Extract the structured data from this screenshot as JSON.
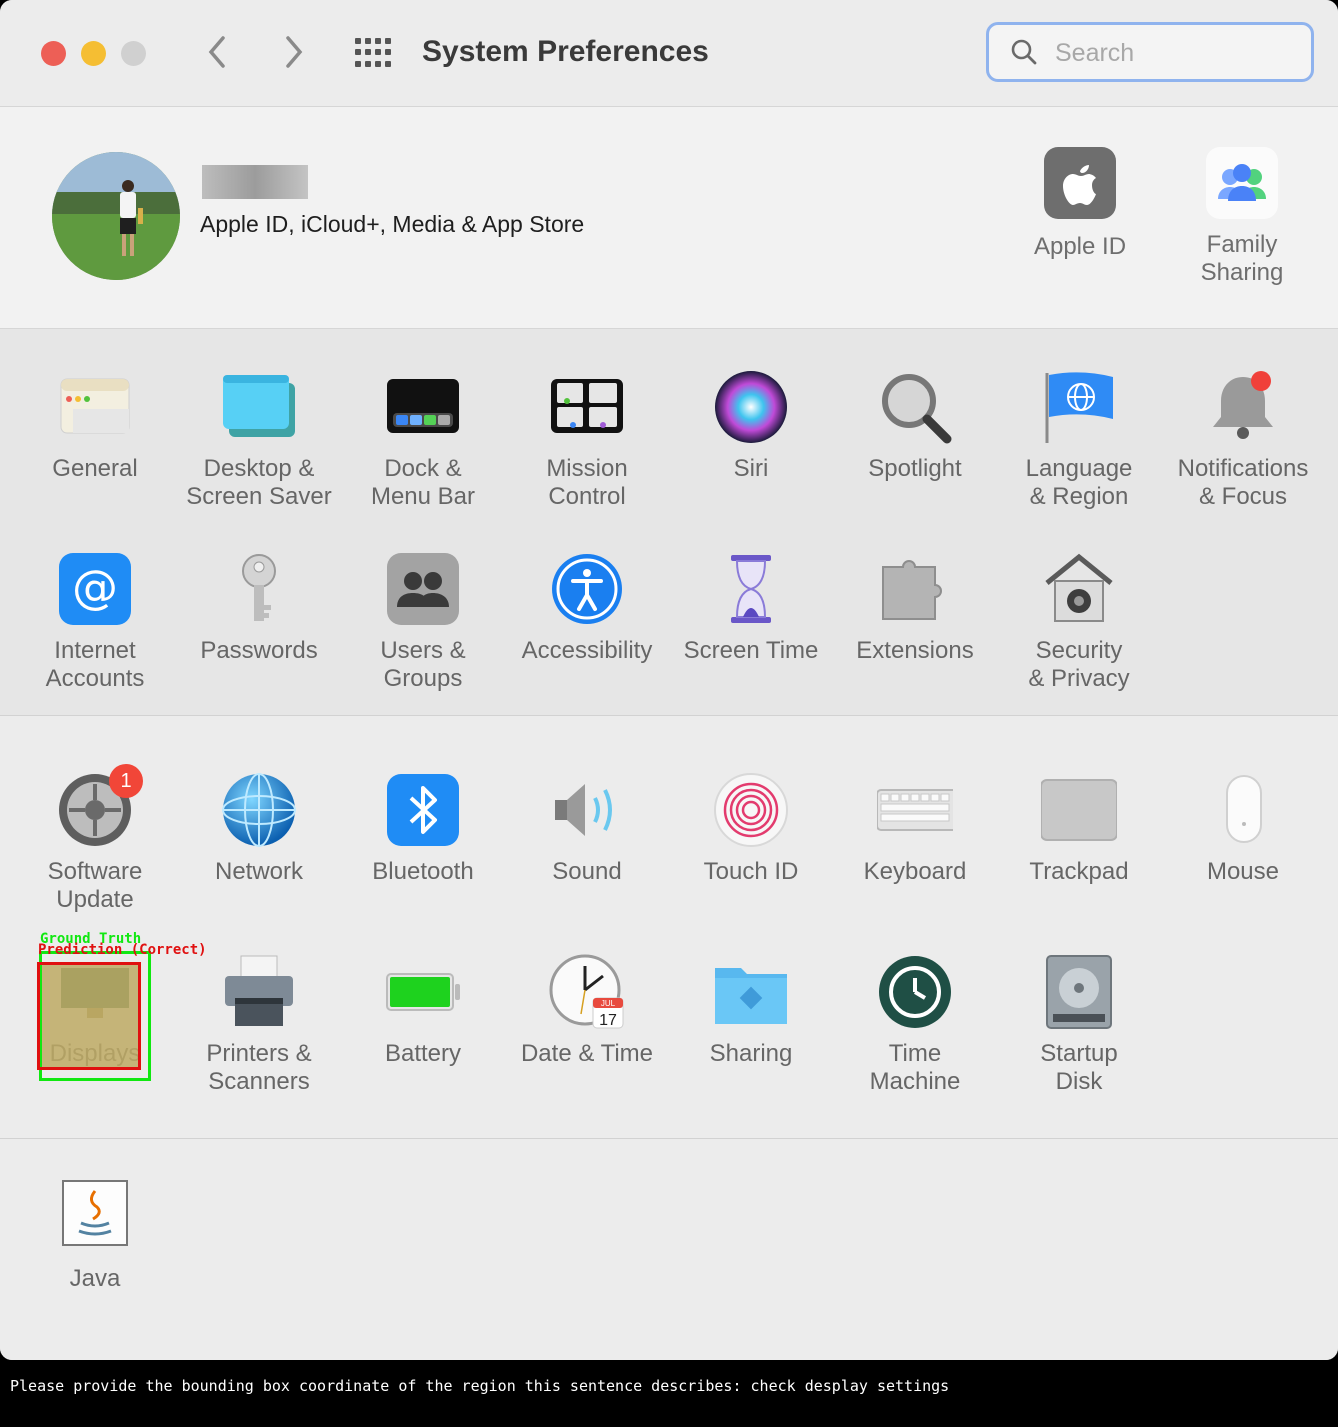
{
  "window": {
    "title": "System Preferences",
    "search_placeholder": "Search"
  },
  "account": {
    "subtitle": "Apple ID, iCloud+, Media & App Store",
    "top_items": [
      {
        "label": "Apple ID",
        "icon": "apple-id-icon"
      },
      {
        "label": "Family\nSharing",
        "icon": "family-sharing-icon"
      }
    ]
  },
  "section1": [
    {
      "label": "General",
      "icon": "general-icon"
    },
    {
      "label": "Desktop &\nScreen Saver",
      "icon": "desktop-screensaver-icon"
    },
    {
      "label": "Dock &\nMenu Bar",
      "icon": "dock-menubar-icon"
    },
    {
      "label": "Mission\nControl",
      "icon": "mission-control-icon"
    },
    {
      "label": "Siri",
      "icon": "siri-icon"
    },
    {
      "label": "Spotlight",
      "icon": "spotlight-icon"
    },
    {
      "label": "Language\n& Region",
      "icon": "language-region-icon"
    },
    {
      "label": "Notifications\n& Focus",
      "icon": "notifications-icon"
    },
    {
      "label": "Internet\nAccounts",
      "icon": "internet-accounts-icon"
    },
    {
      "label": "Passwords",
      "icon": "passwords-icon"
    },
    {
      "label": "Users &\nGroups",
      "icon": "users-groups-icon"
    },
    {
      "label": "Accessibility",
      "icon": "accessibility-icon"
    },
    {
      "label": "Screen Time",
      "icon": "screen-time-icon"
    },
    {
      "label": "Extensions",
      "icon": "extensions-icon"
    },
    {
      "label": "Security\n& Privacy",
      "icon": "security-privacy-icon"
    }
  ],
  "section2": [
    {
      "label": "Software\nUpdate",
      "icon": "software-update-icon",
      "badge": "1"
    },
    {
      "label": "Network",
      "icon": "network-icon"
    },
    {
      "label": "Bluetooth",
      "icon": "bluetooth-icon"
    },
    {
      "label": "Sound",
      "icon": "sound-icon"
    },
    {
      "label": "Touch ID",
      "icon": "touch-id-icon"
    },
    {
      "label": "Keyboard",
      "icon": "keyboard-icon"
    },
    {
      "label": "Trackpad",
      "icon": "trackpad-icon"
    },
    {
      "label": "Mouse",
      "icon": "mouse-icon"
    },
    {
      "label": "Displays",
      "icon": "displays-icon"
    },
    {
      "label": "Printers &\nScanners",
      "icon": "printers-scanners-icon"
    },
    {
      "label": "Battery",
      "icon": "battery-icon"
    },
    {
      "label": "Date & Time",
      "icon": "date-time-icon",
      "calendar_month": "JUL",
      "calendar_day": "17"
    },
    {
      "label": "Sharing",
      "icon": "sharing-icon"
    },
    {
      "label": "Time\nMachine",
      "icon": "time-machine-icon"
    },
    {
      "label": "Startup\nDisk",
      "icon": "startup-disk-icon"
    }
  ],
  "section3": [
    {
      "label": "Java",
      "icon": "java-icon"
    }
  ],
  "annotations": {
    "ground_truth_label": "Ground Truth",
    "prediction_label": "Prediction (Correct)",
    "caption": "Please provide the bounding box coordinate of the region this sentence describes: check desplay settings"
  },
  "colors": {
    "close": "#ed5f56",
    "minimize": "#f5be33",
    "zoom": "#d0d0d0",
    "ground_truth": "#11e811",
    "prediction": "#e01010"
  }
}
